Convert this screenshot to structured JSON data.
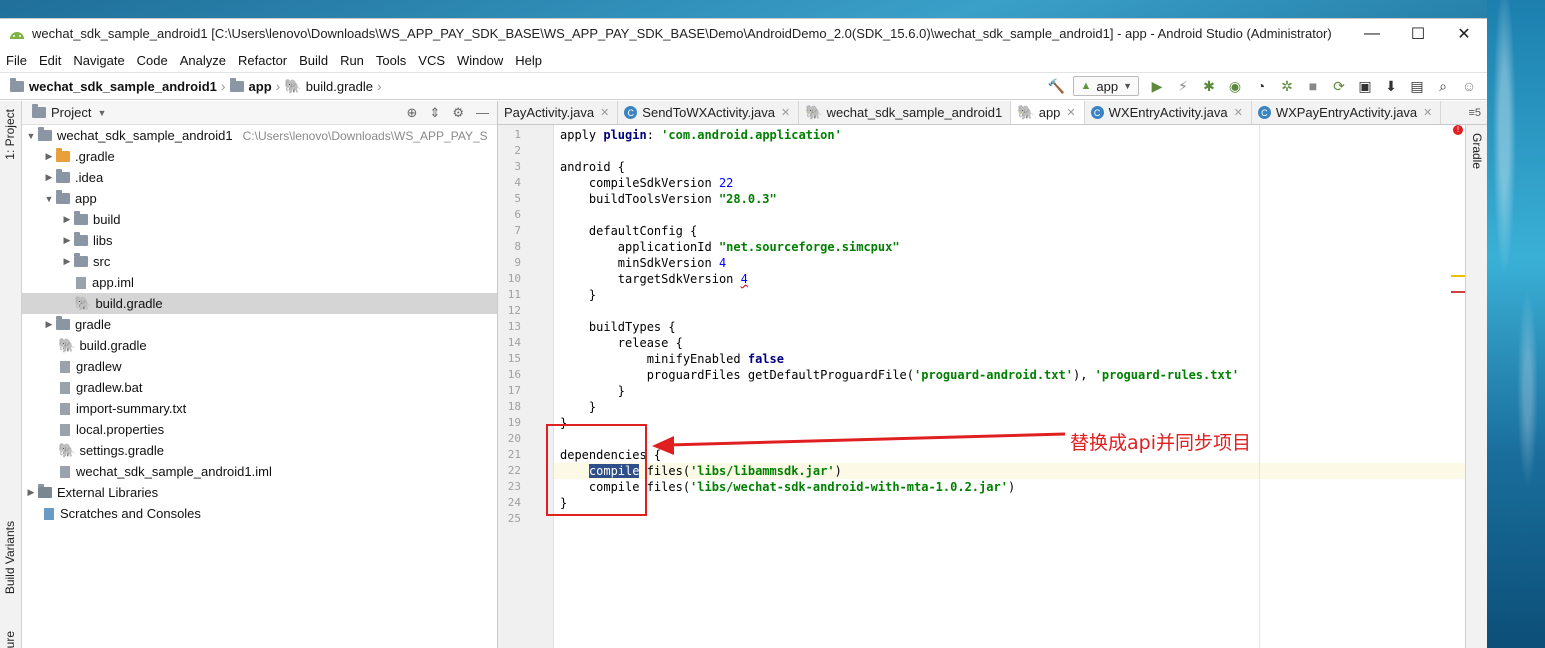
{
  "window": {
    "title": "wechat_sdk_sample_android1 [C:\\Users\\lenovo\\Downloads\\WS_APP_PAY_SDK_BASE\\WS_APP_PAY_SDK_BASE\\Demo\\AndroidDemo_2.0(SDK_15.6.0)\\wechat_sdk_sample_android1] - app - Android Studio (Administrator)",
    "minimize": "—",
    "maximize": "☐",
    "close": "✕"
  },
  "menu": [
    "File",
    "Edit",
    "Navigate",
    "Code",
    "Analyze",
    "Refactor",
    "Build",
    "Run",
    "Tools",
    "VCS",
    "Window",
    "Help"
  ],
  "breadcrumb": {
    "project": "wechat_sdk_sample_android1",
    "module": "app",
    "file": "build.gradle"
  },
  "run_config": "app",
  "left_strip": {
    "project_tab": "1: Project",
    "build_variants_tab": "Build Variants",
    "structure_tab": "ure"
  },
  "right_strip": {
    "gradle_tab": "Gradle"
  },
  "project_panel": {
    "header": "Project",
    "root_name": "wechat_sdk_sample_android1",
    "root_path": "C:\\Users\\lenovo\\Downloads\\WS_APP_PAY_S",
    "items": [
      {
        "label": ".gradle"
      },
      {
        "label": ".idea"
      },
      {
        "label": "app"
      },
      {
        "label": "build"
      },
      {
        "label": "libs"
      },
      {
        "label": "src"
      },
      {
        "label": "app.iml"
      },
      {
        "label": "build.gradle"
      },
      {
        "label": "gradle"
      },
      {
        "label": "build.gradle"
      },
      {
        "label": "gradlew"
      },
      {
        "label": "gradlew.bat"
      },
      {
        "label": "import-summary.txt"
      },
      {
        "label": "local.properties"
      },
      {
        "label": "settings.gradle"
      },
      {
        "label": "wechat_sdk_sample_android1.iml"
      },
      {
        "label": "External Libraries"
      },
      {
        "label": "Scratches and Consoles"
      }
    ]
  },
  "tabs": [
    {
      "label": "PayActivity.java"
    },
    {
      "label": "SendToWXActivity.java"
    },
    {
      "label": "wechat_sdk_sample_android1"
    },
    {
      "label": "app"
    },
    {
      "label": "WXEntryActivity.java"
    },
    {
      "label": "WXPayEntryActivity.java"
    }
  ],
  "tab_overflow": "≡5",
  "code": {
    "line_numbers": [
      "1",
      "2",
      "3",
      "4",
      "5",
      "6",
      "7",
      "8",
      "9",
      "10",
      "11",
      "12",
      "13",
      "14",
      "15",
      "16",
      "17",
      "18",
      "19",
      "20",
      "21",
      "22",
      "23",
      "24",
      "25"
    ],
    "l1_a": "apply ",
    "l1_b": "plugin",
    "l1_c": ": ",
    "l1_d": "'com.android.application'",
    "l3": "android {",
    "l4_a": "    compileSdkVersion ",
    "l4_b": "22",
    "l5_a": "    buildToolsVersion ",
    "l5_b": "\"28.0.3\"",
    "l7": "    defaultConfig {",
    "l8_a": "        applicationId ",
    "l8_b": "\"net.sourceforge.simcpux\"",
    "l9_a": "        minSdkVersion ",
    "l9_b": "4",
    "l10_a": "        targetSdkVersion ",
    "l10_b": "4",
    "l11": "    }",
    "l13": "    buildTypes {",
    "l14": "        release {",
    "l15_a": "            minifyEnabled ",
    "l15_b": "false",
    "l16_a": "            proguardFiles getDefaultProguardFile(",
    "l16_b": "'proguard-android.txt'",
    "l16_c": "), ",
    "l16_d": "'proguard-rules.txt'",
    "l17": "        }",
    "l18": "    }",
    "l19": "}",
    "l21": "dependencies {",
    "l22_a": "    ",
    "l22_b": "compile",
    "l22_c": " files(",
    "l22_d": "'libs/libammsdk.jar'",
    "l22_e": ")",
    "l23_a": "    compile files(",
    "l23_b": "'libs/wechat-sdk-android-with-mta-1.0.2.jar'",
    "l23_c": ")",
    "l24": "}"
  },
  "annotation": {
    "text": "替换成api并同步项目",
    "color": "#e02020"
  }
}
